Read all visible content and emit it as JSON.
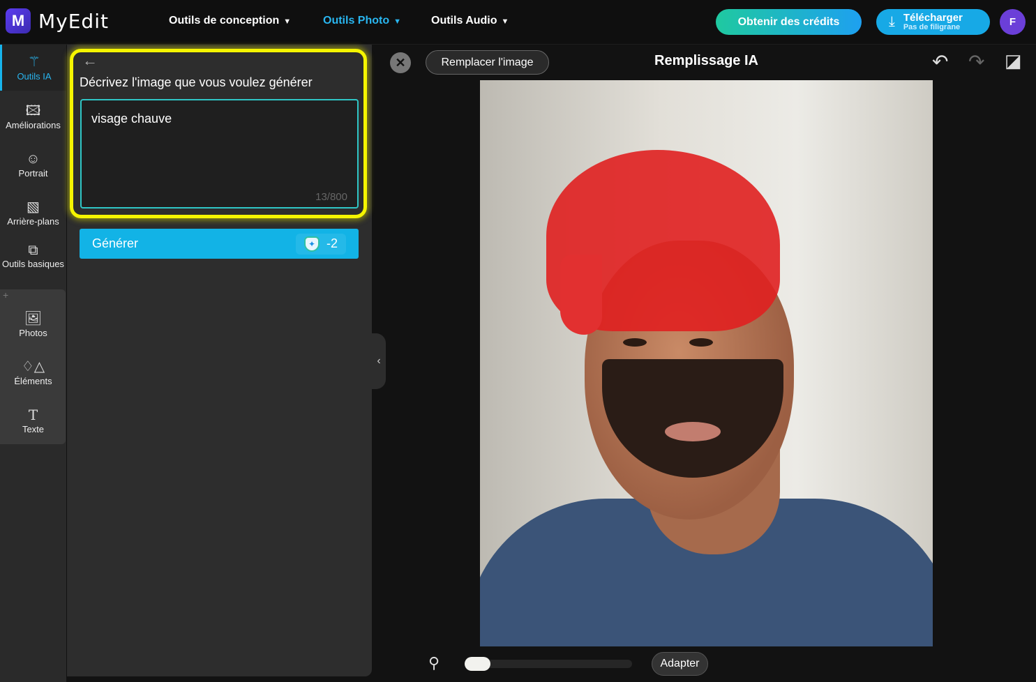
{
  "header": {
    "logo_letter": "M",
    "brand": "MyEdit",
    "nav": [
      {
        "label": "Outils de conception"
      },
      {
        "label": "Outils Photo"
      },
      {
        "label": "Outils Audio"
      }
    ],
    "credits": "Obtenir des crédits",
    "download": "Télécharger",
    "download_sub": "Pas de filigrane",
    "avatar": "F"
  },
  "sidebar": {
    "items": [
      {
        "label": "Outils IA"
      },
      {
        "label": "Améliorations"
      },
      {
        "label": "Portrait"
      },
      {
        "label": "Arrière-plans"
      },
      {
        "label": "Outils basiques"
      },
      {
        "label": "Photos"
      },
      {
        "label": "Éléments"
      },
      {
        "label": "Texte"
      }
    ]
  },
  "panel": {
    "title": "Décrivez l'image que vous voulez générer",
    "prompt_value": "visage chauve",
    "counter": "13/800",
    "generate": "Générer",
    "cost": "-2"
  },
  "canvas": {
    "replace": "Remplacer l'image",
    "title": "Remplissage IA",
    "fit": "Adapter",
    "zoom_level": 0
  },
  "colors": {
    "accent": "#12b3e6",
    "highlight": "#f5f500",
    "mask": "#e02020"
  }
}
